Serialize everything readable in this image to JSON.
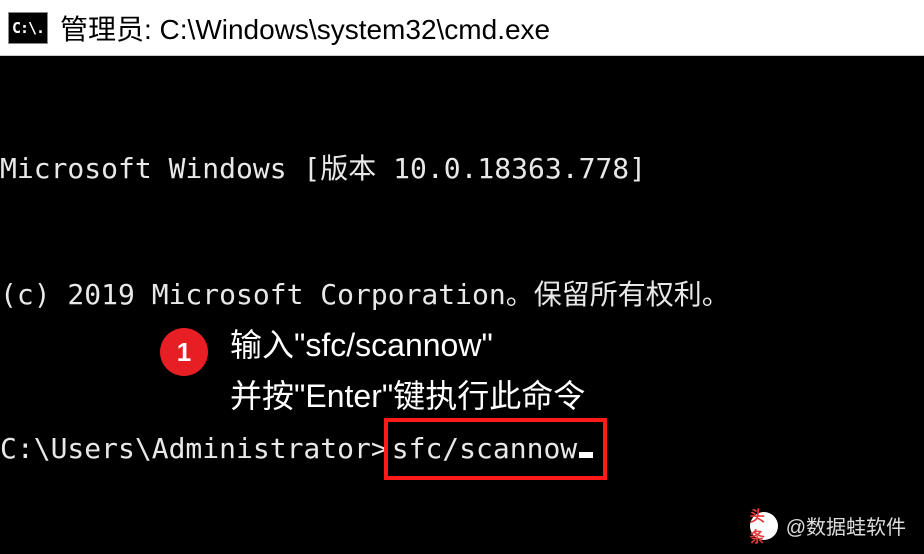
{
  "titlebar": {
    "icon_text": "C:\\.",
    "title": "管理员: C:\\Windows\\system32\\cmd.exe"
  },
  "console": {
    "line1": "Microsoft Windows [版本 10.0.18363.778]",
    "line2": "(c) 2019 Microsoft Corporation。保留所有权利。",
    "prompt": "C:\\Users\\Administrator>",
    "command": "sfc/scannow"
  },
  "annotation": {
    "step_number": "1",
    "line1": "输入\"sfc/scannow\"",
    "line2": "并按\"Enter\"键执行此命令"
  },
  "watermark": {
    "logo_text": "头条",
    "text": "@数据蛙软件"
  }
}
